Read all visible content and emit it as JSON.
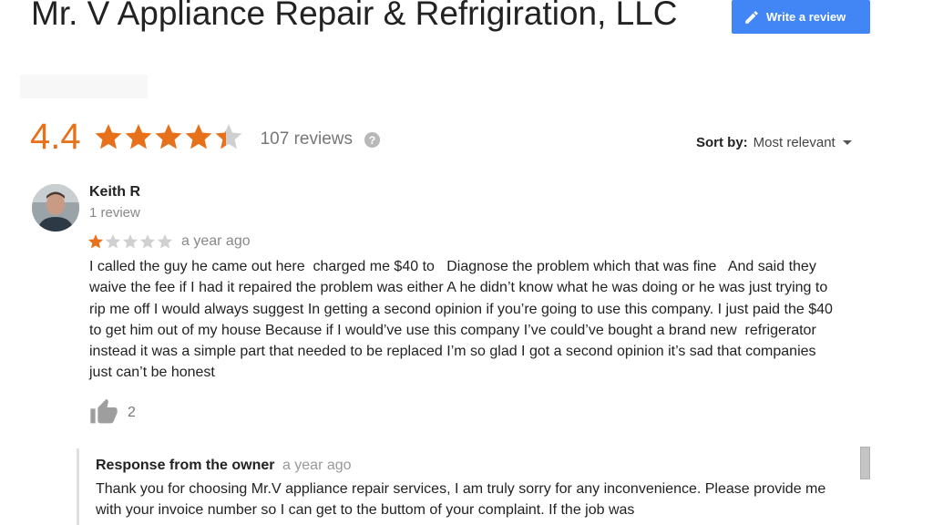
{
  "business": {
    "title": "Mr. V Appliance Repair & Refrigiration, LLC"
  },
  "write_review": {
    "label": "Write a review",
    "icon": "pencil-icon"
  },
  "summary": {
    "rating": "4.4",
    "rating_value": 4.4,
    "max_stars": 5,
    "review_count": "107 reviews",
    "help_icon": "question-circle-icon"
  },
  "sort": {
    "label": "Sort by:",
    "value": "Most relevant",
    "icon": "caret-down-icon"
  },
  "review": {
    "reviewer_name": "Keith R",
    "reviewer_meta": "1 review",
    "rating": 1,
    "max_stars": 5,
    "date": "a year ago",
    "text": "I called the guy he came out here  charged me $40 to   Diagnose the problem which that was fine   And said they waive the fee if I had it repaired the problem was either A he didn’t know what he was doing or he was just trying to rip me off I would always suggest In getting a second opinion if you’re going to use this company. I just paid the $40 to get him out of my house Because if I would’ve use this company I’ve could’ve bought a brand new  refrigerator instead it was a simple part that needed to be replaced I’m so glad I got a second opinion it’s sad that companies just can’t be honest",
    "likes": "2",
    "like_icon": "thumbs-up-icon"
  },
  "owner_response": {
    "label": "Response from the owner",
    "date": "a year ago",
    "text": "Thank you for choosing Mr.V appliance repair services, I am truly sorry for any inconvenience. Please provide me with your invoice number so I can get to the buttom of your complaint. If the job was"
  },
  "colors": {
    "star": "#e7711b",
    "star_empty": "#d0d0d0",
    "button": "#4285f4"
  }
}
